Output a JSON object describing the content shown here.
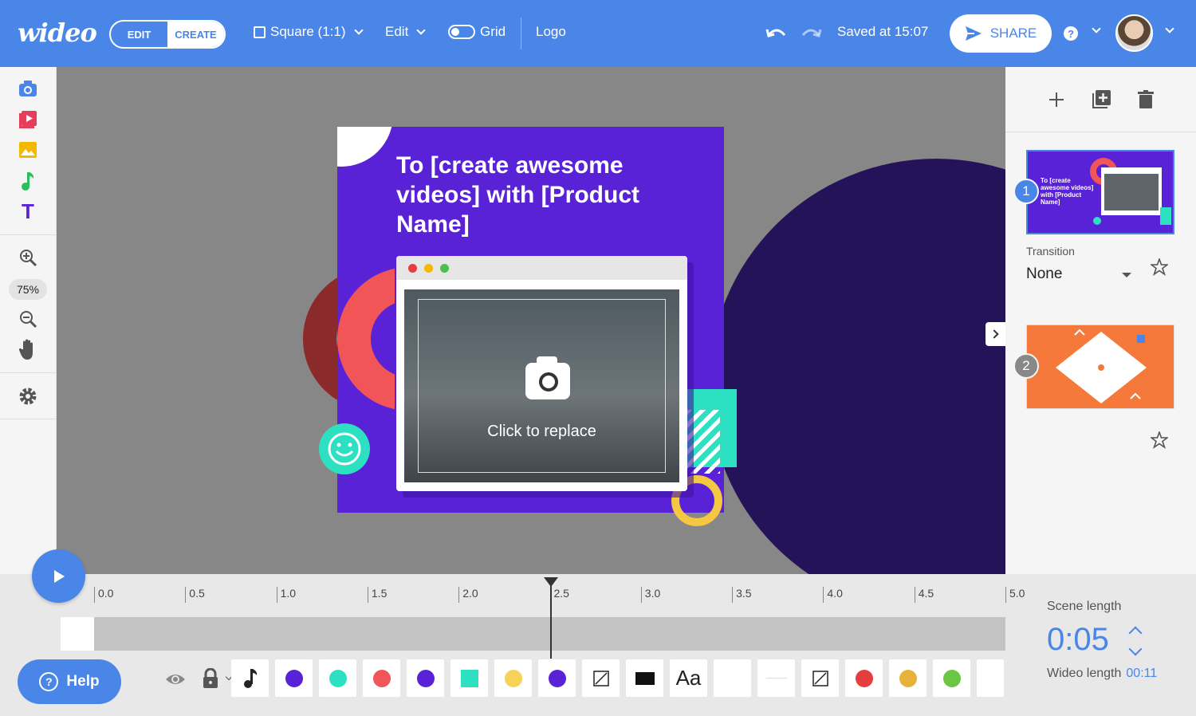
{
  "brand": {
    "logo": "wideo",
    "accent": "#4a86e8"
  },
  "topbar": {
    "mode_edit": "EDIT",
    "mode_create": "CREATE",
    "format": "Square (1:1)",
    "edit_menu": "Edit",
    "grid_label": "Grid",
    "logo_menu": "Logo",
    "saved_status": "Saved at 15:07",
    "share_label": "SHARE",
    "help_glyph": "?"
  },
  "lefttools": {
    "icons": [
      "camera-icon",
      "video-icon",
      "image-icon",
      "music-icon",
      "text-icon",
      "zoom-in-icon",
      "zoom-out-icon",
      "hand-icon",
      "gear-icon"
    ],
    "text_glyph": "T",
    "zoom_level": "75%"
  },
  "scene": {
    "title": "To [create awesome videos] with [Product Name]",
    "placeholder_label": "Click to replace",
    "colors": {
      "background": "#5a22d6",
      "dark": "#25135a",
      "red": "#f25557",
      "teal": "#2ee0c2",
      "yellow": "#f5c842"
    }
  },
  "rightpanel": {
    "scenes": [
      {
        "number": "1"
      },
      {
        "number": "2"
      }
    ],
    "transition_label": "Transition",
    "transition_value": "None"
  },
  "timeline": {
    "ticks": [
      "0.0",
      "0.5",
      "1.0",
      "1.5",
      "2.0",
      "2.5",
      "3.0",
      "3.5",
      "4.0",
      "4.5",
      "5.0"
    ],
    "playhead_time": 2.5,
    "help_label": "Help",
    "help_glyph": "?",
    "text_layer_label": "Aa",
    "layer_colors": [
      "#5a22d6",
      "#2ee0c2",
      "#f25557",
      "#5a22d6",
      "#2ee0c2",
      "#f5c842",
      "#5a22d6",
      "#e53e3e",
      "#e8b23a",
      "#6cc644"
    ],
    "scene_length_label": "Scene length",
    "scene_length_value": "0:05",
    "wideo_length_label": "Wideo length",
    "wideo_length_value": "00:11"
  }
}
